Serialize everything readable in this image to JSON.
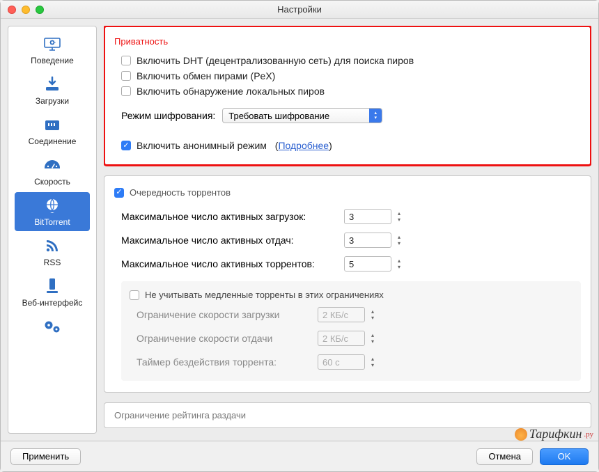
{
  "window": {
    "title": "Настройки"
  },
  "sidebar": {
    "items": [
      {
        "label": "Поведение"
      },
      {
        "label": "Загрузки"
      },
      {
        "label": "Соединение"
      },
      {
        "label": "Скорость"
      },
      {
        "label": "BitTorrent"
      },
      {
        "label": "RSS"
      },
      {
        "label": "Веб-интерфейс"
      },
      {
        "label": ""
      }
    ]
  },
  "privacy": {
    "title": "Приватность",
    "dht_label": "Включить DHT (децентрализованную сеть) для поиска пиров",
    "pex_label": "Включить обмен пирами (PeX)",
    "local_label": "Включить обнаружение локальных пиров",
    "encryption_label": "Режим шифрования:",
    "encryption_value": "Требовать шифрование",
    "anon_label": "Включить анонимный режим",
    "anon_more": "Подробнее"
  },
  "queue": {
    "title": "Очередность торрентов",
    "max_downloads_label": "Максимальное число активных загрузок:",
    "max_downloads_value": "3",
    "max_uploads_label": "Максимальное число активных отдач:",
    "max_uploads_value": "3",
    "max_active_label": "Максимальное число активных торрентов:",
    "max_active_value": "5",
    "ignore_slow_label": "Не учитывать медленные торренты в этих ограничениях",
    "dl_limit_label": "Ограничение скорости загрузки",
    "dl_limit_value": "2 КБ/с",
    "ul_limit_label": "Ограничение скорости отдачи",
    "ul_limit_value": "2 КБ/с",
    "idle_label": "Таймер бездействия торрента:",
    "idle_value": "60 с"
  },
  "ratio": {
    "title": "Ограничение рейтинга раздачи"
  },
  "footer": {
    "apply": "Применить",
    "cancel": "Отмена",
    "ok": "OK"
  },
  "watermark": {
    "text": "Тарифкин",
    "suffix": ".ру"
  }
}
